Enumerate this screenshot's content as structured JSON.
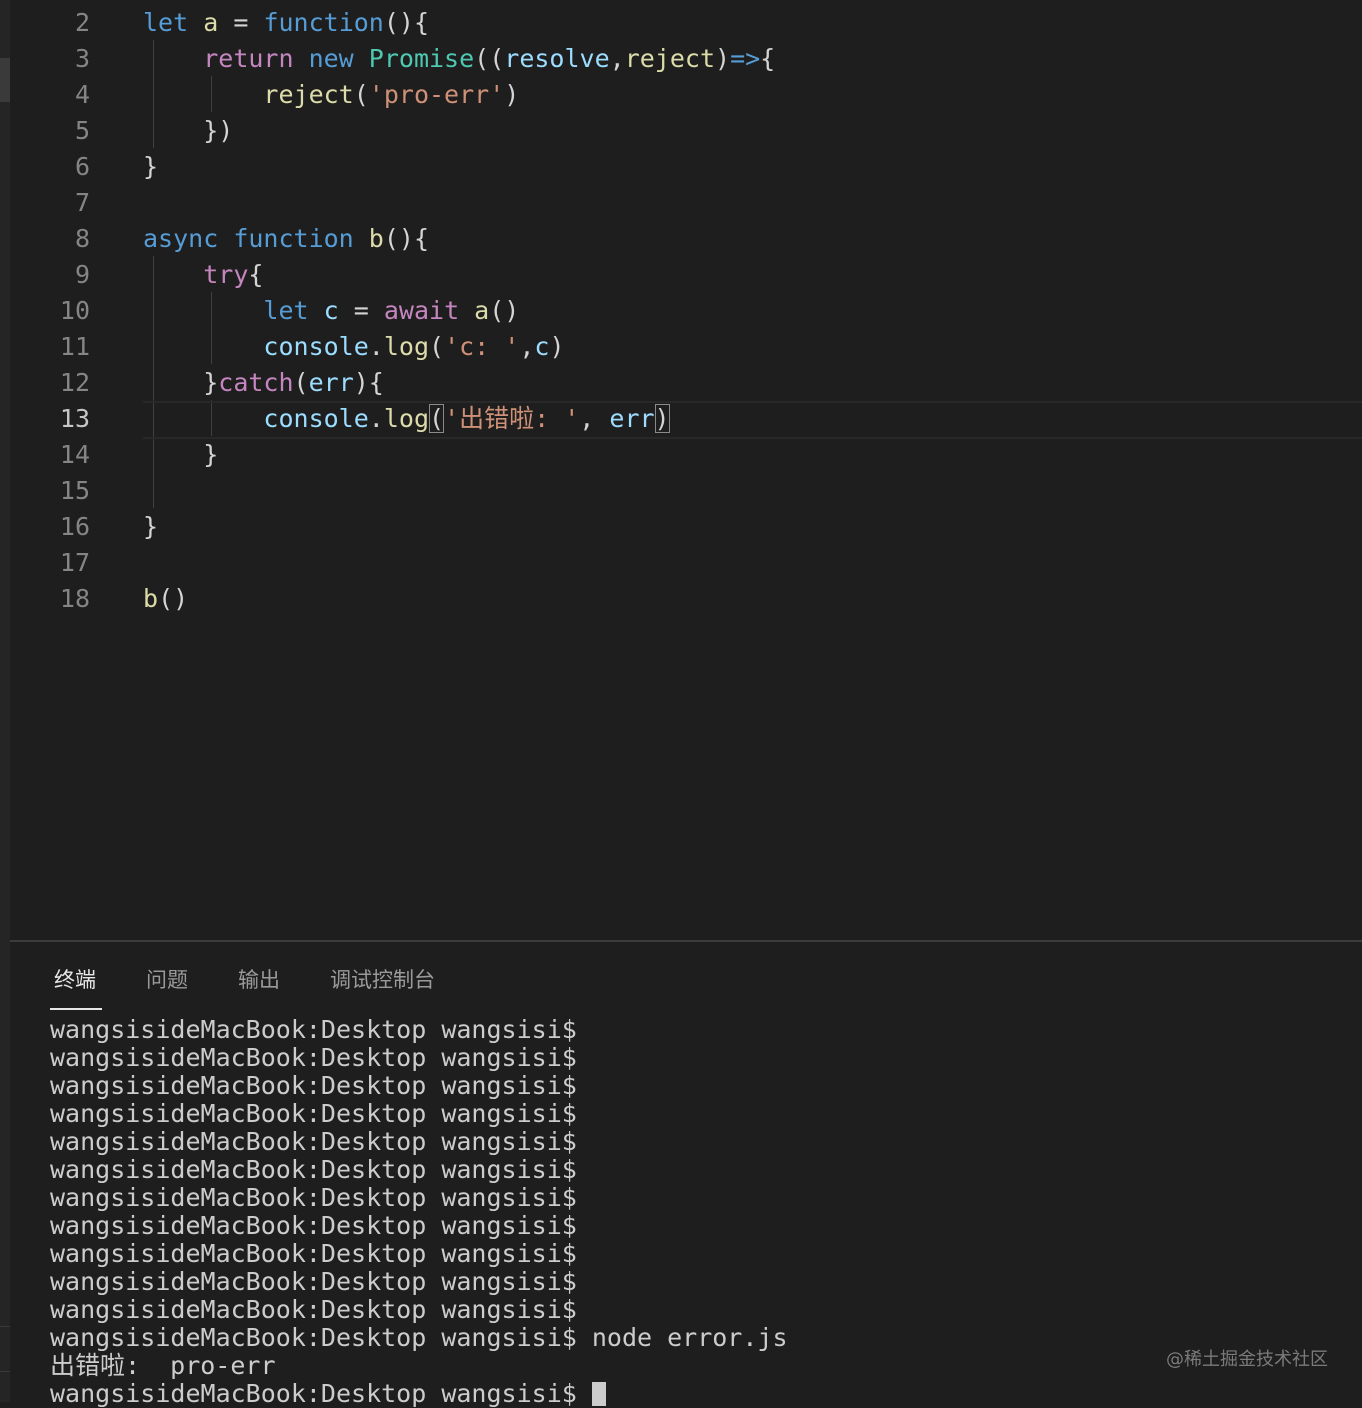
{
  "editor": {
    "lines": [
      {
        "n": "2",
        "tokens": [
          {
            "t": "let ",
            "c": "kw"
          },
          {
            "t": "a",
            "c": "fn"
          },
          {
            "t": " = ",
            "c": "op"
          },
          {
            "t": "function",
            "c": "kw"
          },
          {
            "t": "(){",
            "c": "op"
          }
        ]
      },
      {
        "n": "3",
        "tokens": [
          {
            "t": "    ",
            "c": "op"
          },
          {
            "t": "return ",
            "c": "ctrl"
          },
          {
            "t": "new ",
            "c": "kw"
          },
          {
            "t": "Promise",
            "c": "cls"
          },
          {
            "t": "((",
            "c": "op"
          },
          {
            "t": "resolve",
            "c": "param"
          },
          {
            "t": ",",
            "c": "op"
          },
          {
            "t": "reject",
            "c": "fn"
          },
          {
            "t": ")",
            "c": "op"
          },
          {
            "t": "=>",
            "c": "kw"
          },
          {
            "t": "{",
            "c": "op"
          }
        ]
      },
      {
        "n": "4",
        "tokens": [
          {
            "t": "        ",
            "c": "op"
          },
          {
            "t": "reject",
            "c": "fn"
          },
          {
            "t": "(",
            "c": "op"
          },
          {
            "t": "'pro-err'",
            "c": "str"
          },
          {
            "t": ")",
            "c": "op"
          }
        ]
      },
      {
        "n": "5",
        "tokens": [
          {
            "t": "    })",
            "c": "op"
          }
        ]
      },
      {
        "n": "6",
        "tokens": [
          {
            "t": "}",
            "c": "op"
          }
        ]
      },
      {
        "n": "7",
        "tokens": []
      },
      {
        "n": "8",
        "tokens": [
          {
            "t": "async ",
            "c": "kw"
          },
          {
            "t": "function ",
            "c": "kw"
          },
          {
            "t": "b",
            "c": "fn"
          },
          {
            "t": "(){",
            "c": "op"
          }
        ]
      },
      {
        "n": "9",
        "tokens": [
          {
            "t": "    ",
            "c": "op"
          },
          {
            "t": "try",
            "c": "ctrl"
          },
          {
            "t": "{",
            "c": "op"
          }
        ]
      },
      {
        "n": "10",
        "tokens": [
          {
            "t": "        ",
            "c": "op"
          },
          {
            "t": "let ",
            "c": "kw"
          },
          {
            "t": "c",
            "c": "var"
          },
          {
            "t": " = ",
            "c": "op"
          },
          {
            "t": "await ",
            "c": "ctrl"
          },
          {
            "t": "a",
            "c": "fn"
          },
          {
            "t": "()",
            "c": "op"
          }
        ]
      },
      {
        "n": "11",
        "tokens": [
          {
            "t": "        ",
            "c": "op"
          },
          {
            "t": "console",
            "c": "var"
          },
          {
            "t": ".",
            "c": "op"
          },
          {
            "t": "log",
            "c": "fn"
          },
          {
            "t": "(",
            "c": "op"
          },
          {
            "t": "'c: '",
            "c": "str"
          },
          {
            "t": ",",
            "c": "op"
          },
          {
            "t": "c",
            "c": "var"
          },
          {
            "t": ")",
            "c": "op"
          }
        ]
      },
      {
        "n": "12",
        "tokens": [
          {
            "t": "    }",
            "c": "op"
          },
          {
            "t": "catch",
            "c": "ctrl"
          },
          {
            "t": "(",
            "c": "op"
          },
          {
            "t": "err",
            "c": "var"
          },
          {
            "t": "){",
            "c": "op"
          }
        ]
      },
      {
        "n": "13",
        "tokens": [
          {
            "t": "        ",
            "c": "op"
          },
          {
            "t": "console",
            "c": "var"
          },
          {
            "t": ".",
            "c": "op"
          },
          {
            "t": "log",
            "c": "fn"
          },
          {
            "t": "(",
            "c": "op",
            "box": true
          },
          {
            "t": "'出错啦: '",
            "c": "str"
          },
          {
            "t": ", ",
            "c": "op"
          },
          {
            "t": "err",
            "c": "var"
          },
          {
            "t": ")",
            "c": "op",
            "box": true
          }
        ]
      },
      {
        "n": "14",
        "tokens": [
          {
            "t": "    }",
            "c": "op"
          }
        ]
      },
      {
        "n": "15",
        "tokens": []
      },
      {
        "n": "16",
        "tokens": [
          {
            "t": "}",
            "c": "op"
          }
        ]
      },
      {
        "n": "17",
        "tokens": []
      },
      {
        "n": "18",
        "tokens": [
          {
            "t": "b",
            "c": "fn"
          },
          {
            "t": "()",
            "c": "op"
          }
        ]
      }
    ],
    "current_line": "13"
  },
  "panel": {
    "tabs": [
      {
        "label": "终端",
        "active": true
      },
      {
        "label": "问题",
        "active": false
      },
      {
        "label": "输出",
        "active": false
      },
      {
        "label": "调试控制台",
        "active": false
      }
    ]
  },
  "terminal": {
    "lines": [
      "wangsisideMacBook:Desktop wangsisi$",
      "wangsisideMacBook:Desktop wangsisi$",
      "wangsisideMacBook:Desktop wangsisi$",
      "wangsisideMacBook:Desktop wangsisi$",
      "wangsisideMacBook:Desktop wangsisi$",
      "wangsisideMacBook:Desktop wangsisi$",
      "wangsisideMacBook:Desktop wangsisi$",
      "wangsisideMacBook:Desktop wangsisi$",
      "wangsisideMacBook:Desktop wangsisi$",
      "wangsisideMacBook:Desktop wangsisi$",
      "wangsisideMacBook:Desktop wangsisi$",
      "wangsisideMacBook:Desktop wangsisi$ node error.js",
      "出错啦:  pro-err"
    ],
    "prompt": "wangsisideMacBook:Desktop wangsisi$ "
  },
  "watermark": "@稀土掘金技术社区"
}
